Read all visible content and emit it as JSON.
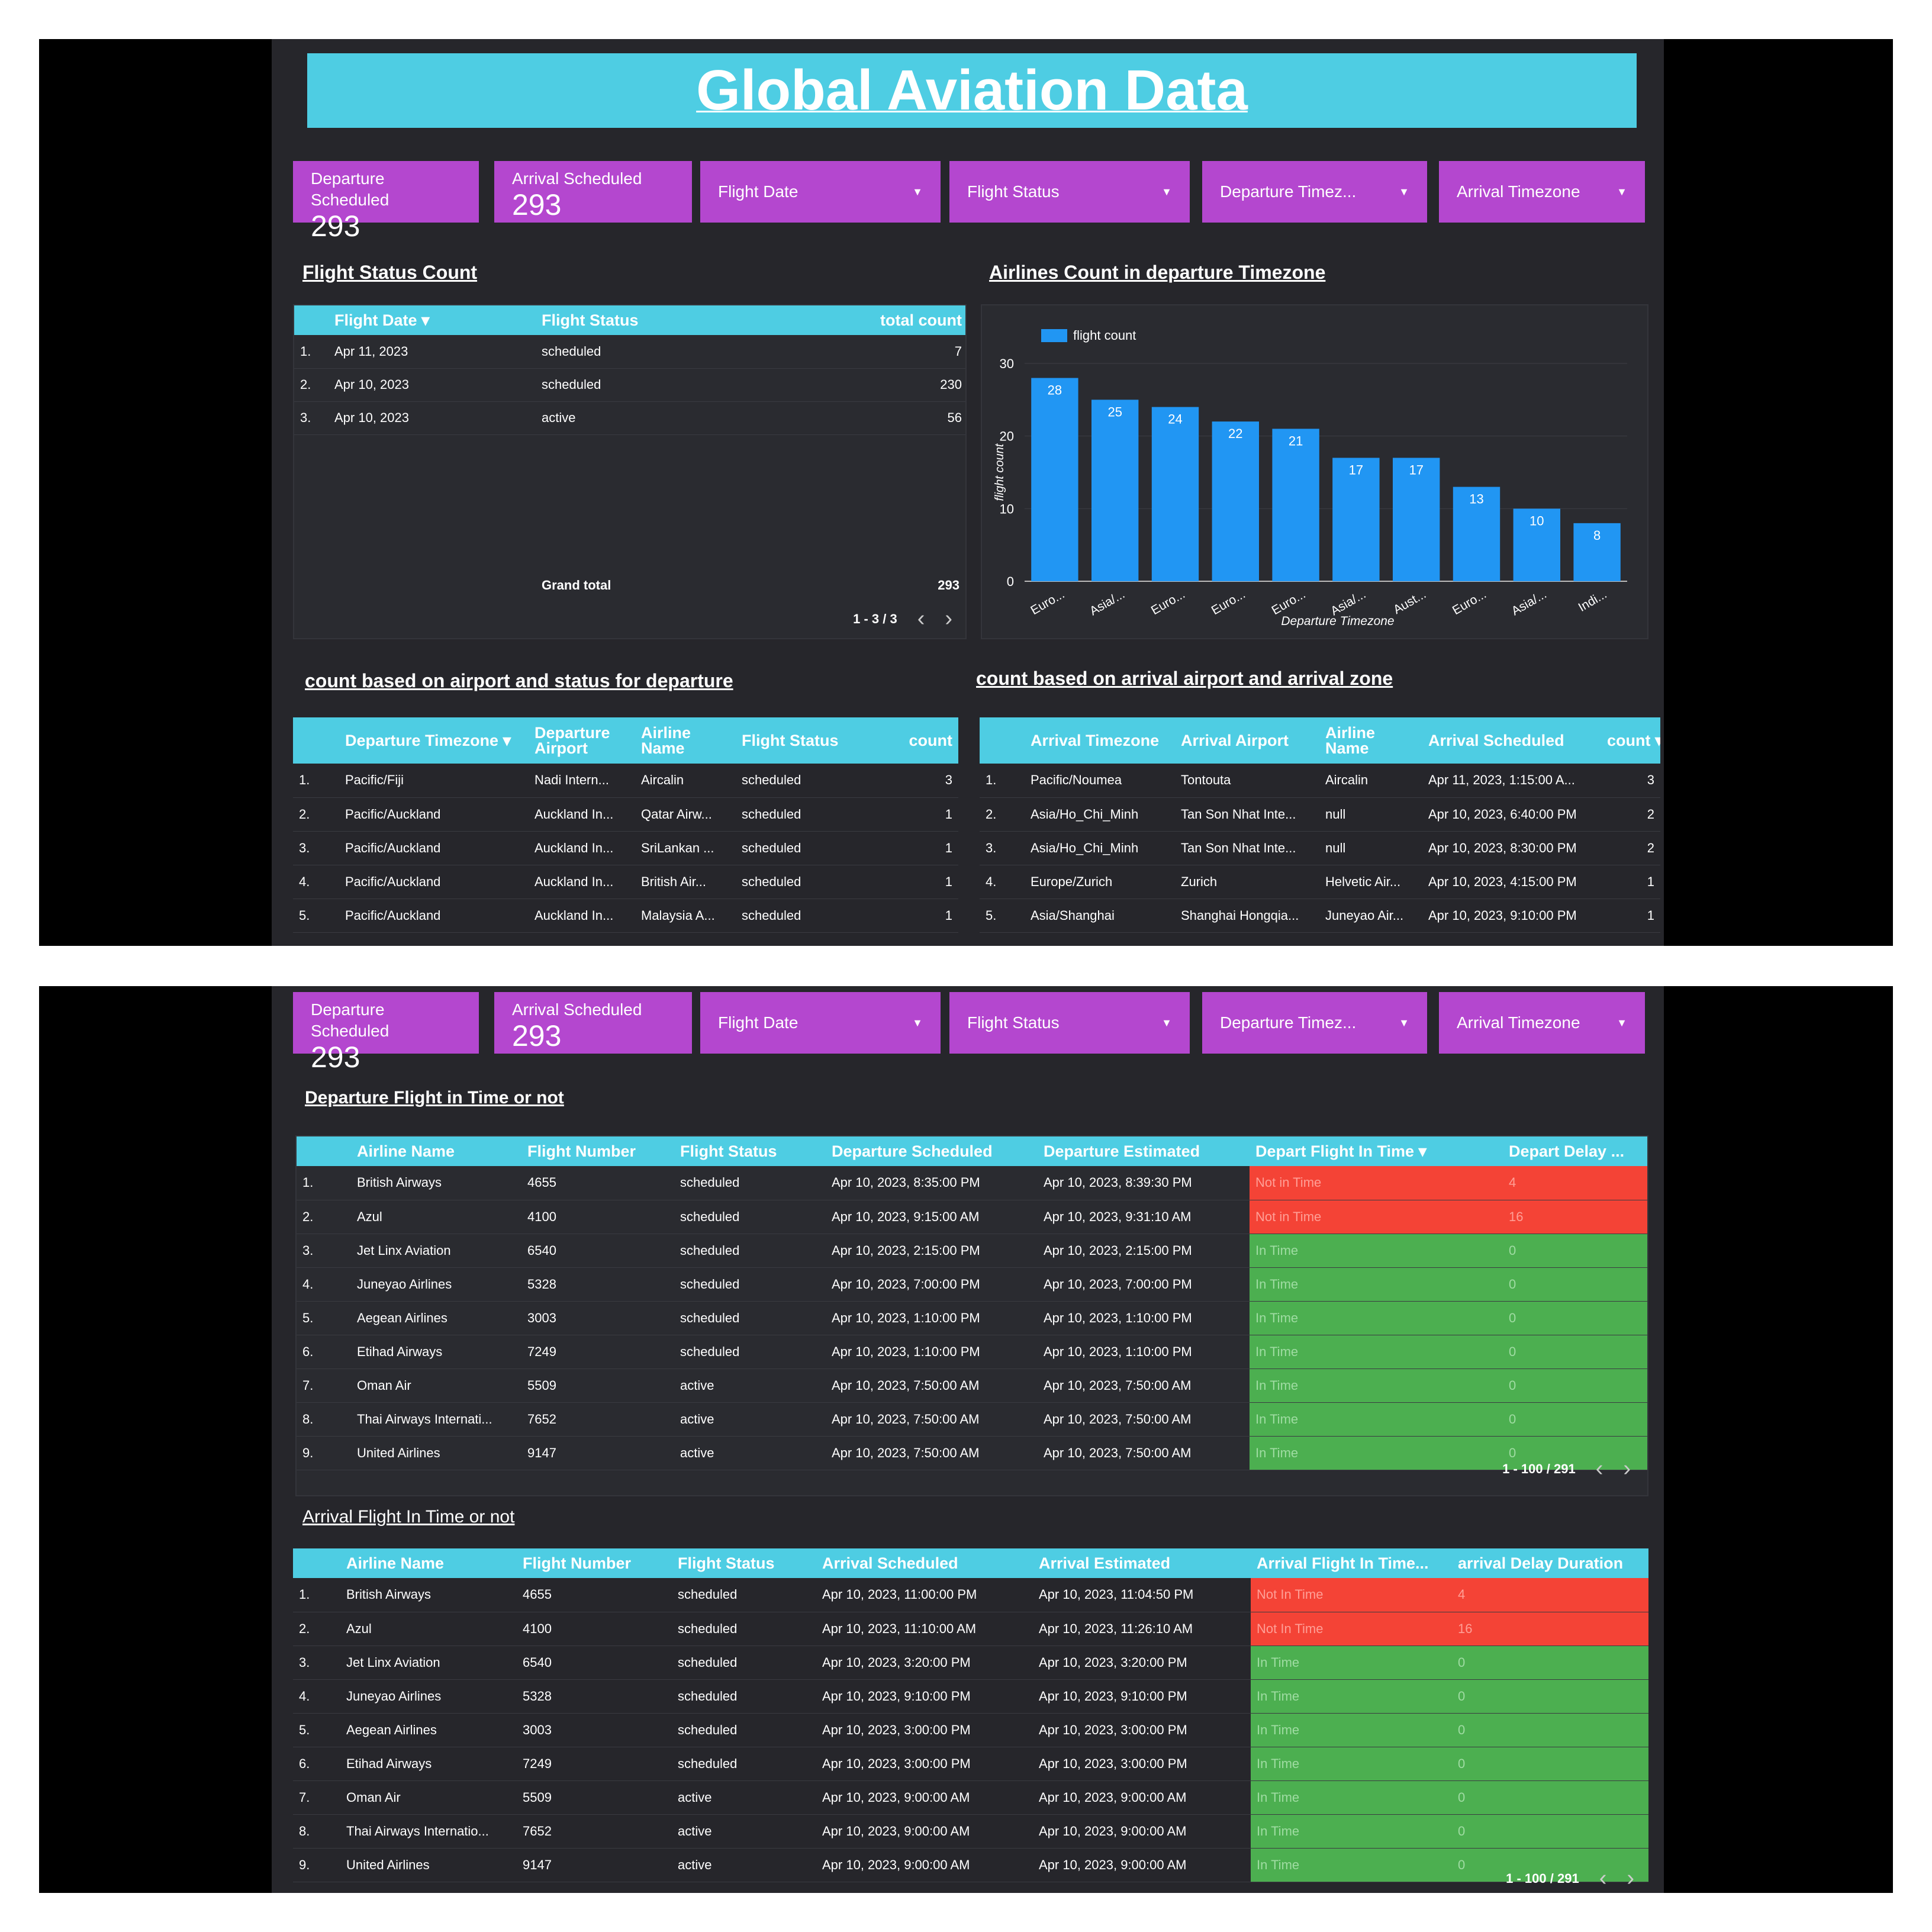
{
  "header": {
    "title": "Global Aviation Data"
  },
  "controls": {
    "departure_scheduled_label": "Departure Scheduled",
    "departure_scheduled_value": "293",
    "arrival_scheduled_label": "Arrival Scheduled",
    "arrival_scheduled_value": "293",
    "filter_flight_date": "Flight Date",
    "filter_flight_status": "Flight Status",
    "filter_departure_timezone": "Departure Timez...",
    "filter_arrival_timezone": "Arrival Timezone",
    "caret": "▼"
  },
  "status_count": {
    "title": "Flight Status Count",
    "columns": [
      "Flight Date ▾",
      "Flight Status",
      "total count"
    ],
    "rows": [
      [
        "1.",
        "Apr 11, 2023",
        "scheduled",
        "7"
      ],
      [
        "2.",
        "Apr 10, 2023",
        "scheduled",
        "230"
      ],
      [
        "3.",
        "Apr 10, 2023",
        "active",
        "56"
      ]
    ],
    "grand_total_label": "Grand total",
    "grand_total_value": "293",
    "pager": "1 - 3 / 3"
  },
  "airlines_chart": {
    "title": "Airlines Count in departure Timezone"
  },
  "chart_data": {
    "type": "bar",
    "legend": "flight count",
    "legend_position": "top-left",
    "categories": [
      "Euro...",
      "Asia/...",
      "Euro...",
      "Euro...",
      "Euro...",
      "Asia/...",
      "Aust...",
      "Euro...",
      "Asia/...",
      "Indi..."
    ],
    "values": [
      28,
      25,
      24,
      22,
      21,
      17,
      17,
      13,
      10,
      8
    ],
    "xlabel": "Departure Timezone",
    "ylabel": "flight count",
    "ylim": [
      0,
      30
    ],
    "yticks": [
      "0",
      "10",
      "20",
      "30"
    ],
    "grid": true,
    "color": "#2196f3"
  },
  "dep_airport": {
    "title": "count based on airport and status for departure",
    "columns": [
      "Departure Timezone ▾",
      "Departure Airport",
      "Airline Name",
      "Flight Status",
      "count"
    ],
    "rows": [
      [
        "1.",
        "Pacific/Fiji",
        "Nadi Intern...",
        "Aircalin",
        "scheduled",
        "3"
      ],
      [
        "2.",
        "Pacific/Auckland",
        "Auckland In...",
        "Qatar Airw...",
        "scheduled",
        "1"
      ],
      [
        "3.",
        "Pacific/Auckland",
        "Auckland In...",
        "SriLankan ...",
        "scheduled",
        "1"
      ],
      [
        "4.",
        "Pacific/Auckland",
        "Auckland In...",
        "British Air...",
        "scheduled",
        "1"
      ],
      [
        "5.",
        "Pacific/Auckland",
        "Auckland In...",
        "Malaysia A...",
        "scheduled",
        "1"
      ]
    ]
  },
  "arr_airport": {
    "title": "count based on arrival airport and arrival zone",
    "columns": [
      "Arrival Timezone",
      "Arrival Airport",
      "Airline Name",
      "Arrival Scheduled",
      "count ▾"
    ],
    "rows": [
      [
        "1.",
        "Pacific/Noumea",
        "Tontouta",
        "Aircalin",
        "Apr 11, 2023, 1:15:00 A...",
        "3"
      ],
      [
        "2.",
        "Asia/Ho_Chi_Minh",
        "Tan Son Nhat Inte...",
        "null",
        "Apr 10, 2023, 6:40:00 PM",
        "2"
      ],
      [
        "3.",
        "Asia/Ho_Chi_Minh",
        "Tan Son Nhat Inte...",
        "null",
        "Apr 10, 2023, 8:30:00 PM",
        "2"
      ],
      [
        "4.",
        "Europe/Zurich",
        "Zurich",
        "Helvetic Air...",
        "Apr 10, 2023, 4:15:00 PM",
        "1"
      ],
      [
        "5.",
        "Asia/Shanghai",
        "Shanghai Hongqia...",
        "Juneyao Air...",
        "Apr 10, 2023, 9:10:00 PM",
        "1"
      ]
    ]
  },
  "departure_in_time": {
    "title": "Departure Flight in Time or not",
    "columns": [
      "Airline Name",
      "Flight Number",
      "Flight Status",
      "Departure Scheduled",
      "Departure Estimated",
      "Depart Flight In Time ▾",
      "Depart Delay ..."
    ],
    "rows": [
      [
        "1.",
        "British Airways",
        "4655",
        "scheduled",
        "Apr 10, 2023, 8:35:00 PM",
        "Apr 10, 2023, 8:39:30 PM",
        "Not in Time",
        "4"
      ],
      [
        "2.",
        "Azul",
        "4100",
        "scheduled",
        "Apr 10, 2023, 9:15:00 AM",
        "Apr 10, 2023, 9:31:10 AM",
        "Not in Time",
        "16"
      ],
      [
        "3.",
        "Jet Linx Aviation",
        "6540",
        "scheduled",
        "Apr 10, 2023, 2:15:00 PM",
        "Apr 10, 2023, 2:15:00 PM",
        "In Time",
        "0"
      ],
      [
        "4.",
        "Juneyao Airlines",
        "5328",
        "scheduled",
        "Apr 10, 2023, 7:00:00 PM",
        "Apr 10, 2023, 7:00:00 PM",
        "In Time",
        "0"
      ],
      [
        "5.",
        "Aegean Airlines",
        "3003",
        "scheduled",
        "Apr 10, 2023, 1:10:00 PM",
        "Apr 10, 2023, 1:10:00 PM",
        "In Time",
        "0"
      ],
      [
        "6.",
        "Etihad Airways",
        "7249",
        "scheduled",
        "Apr 10, 2023, 1:10:00 PM",
        "Apr 10, 2023, 1:10:00 PM",
        "In Time",
        "0"
      ],
      [
        "7.",
        "Oman Air",
        "5509",
        "active",
        "Apr 10, 2023, 7:50:00 AM",
        "Apr 10, 2023, 7:50:00 AM",
        "In Time",
        "0"
      ],
      [
        "8.",
        "Thai Airways Internati...",
        "7652",
        "active",
        "Apr 10, 2023, 7:50:00 AM",
        "Apr 10, 2023, 7:50:00 AM",
        "In Time",
        "0"
      ],
      [
        "9.",
        "United Airlines",
        "9147",
        "active",
        "Apr 10, 2023, 7:50:00 AM",
        "Apr 10, 2023, 7:50:00 AM",
        "In Time",
        "0"
      ]
    ],
    "pager": "1 - 100 / 291"
  },
  "arrival_in_time": {
    "title": "Arrival Flight In Time or not",
    "columns": [
      "Airline Name",
      "Flight Number",
      "Flight Status",
      "Arrival Scheduled",
      "Arrival Estimated",
      "Arrival Flight In Time...",
      "arrival Delay Duration"
    ],
    "rows": [
      [
        "1.",
        "British Airways",
        "4655",
        "scheduled",
        "Apr 10, 2023, 11:00:00 PM",
        "Apr 10, 2023, 11:04:50 PM",
        "Not In Time",
        "4"
      ],
      [
        "2.",
        "Azul",
        "4100",
        "scheduled",
        "Apr 10, 2023, 11:10:00 AM",
        "Apr 10, 2023, 11:26:10 AM",
        "Not In Time",
        "16"
      ],
      [
        "3.",
        "Jet Linx Aviation",
        "6540",
        "scheduled",
        "Apr 10, 2023, 3:20:00 PM",
        "Apr 10, 2023, 3:20:00 PM",
        "In Time",
        "0"
      ],
      [
        "4.",
        "Juneyao Airlines",
        "5328",
        "scheduled",
        "Apr 10, 2023, 9:10:00 PM",
        "Apr 10, 2023, 9:10:00 PM",
        "In Time",
        "0"
      ],
      [
        "5.",
        "Aegean Airlines",
        "3003",
        "scheduled",
        "Apr 10, 2023, 3:00:00 PM",
        "Apr 10, 2023, 3:00:00 PM",
        "In Time",
        "0"
      ],
      [
        "6.",
        "Etihad Airways",
        "7249",
        "scheduled",
        "Apr 10, 2023, 3:00:00 PM",
        "Apr 10, 2023, 3:00:00 PM",
        "In Time",
        "0"
      ],
      [
        "7.",
        "Oman Air",
        "5509",
        "active",
        "Apr 10, 2023, 9:00:00 AM",
        "Apr 10, 2023, 9:00:00 AM",
        "In Time",
        "0"
      ],
      [
        "8.",
        "Thai Airways Internatio...",
        "7652",
        "active",
        "Apr 10, 2023, 9:00:00 AM",
        "Apr 10, 2023, 9:00:00 AM",
        "In Time",
        "0"
      ],
      [
        "9.",
        "United Airlines",
        "9147",
        "active",
        "Apr 10, 2023, 9:00:00 AM",
        "Apr 10, 2023, 9:00:00 AM",
        "In Time",
        "0"
      ]
    ],
    "pager": "1 - 100 / 291"
  },
  "icons": {
    "prev": "‹",
    "next": "›"
  },
  "colors": {
    "accent": "#4ecde3",
    "control": "#b447cf",
    "bar": "#2196f3",
    "not_in_time": "#f44336",
    "in_time": "#4caf50",
    "background": "#26262b"
  }
}
